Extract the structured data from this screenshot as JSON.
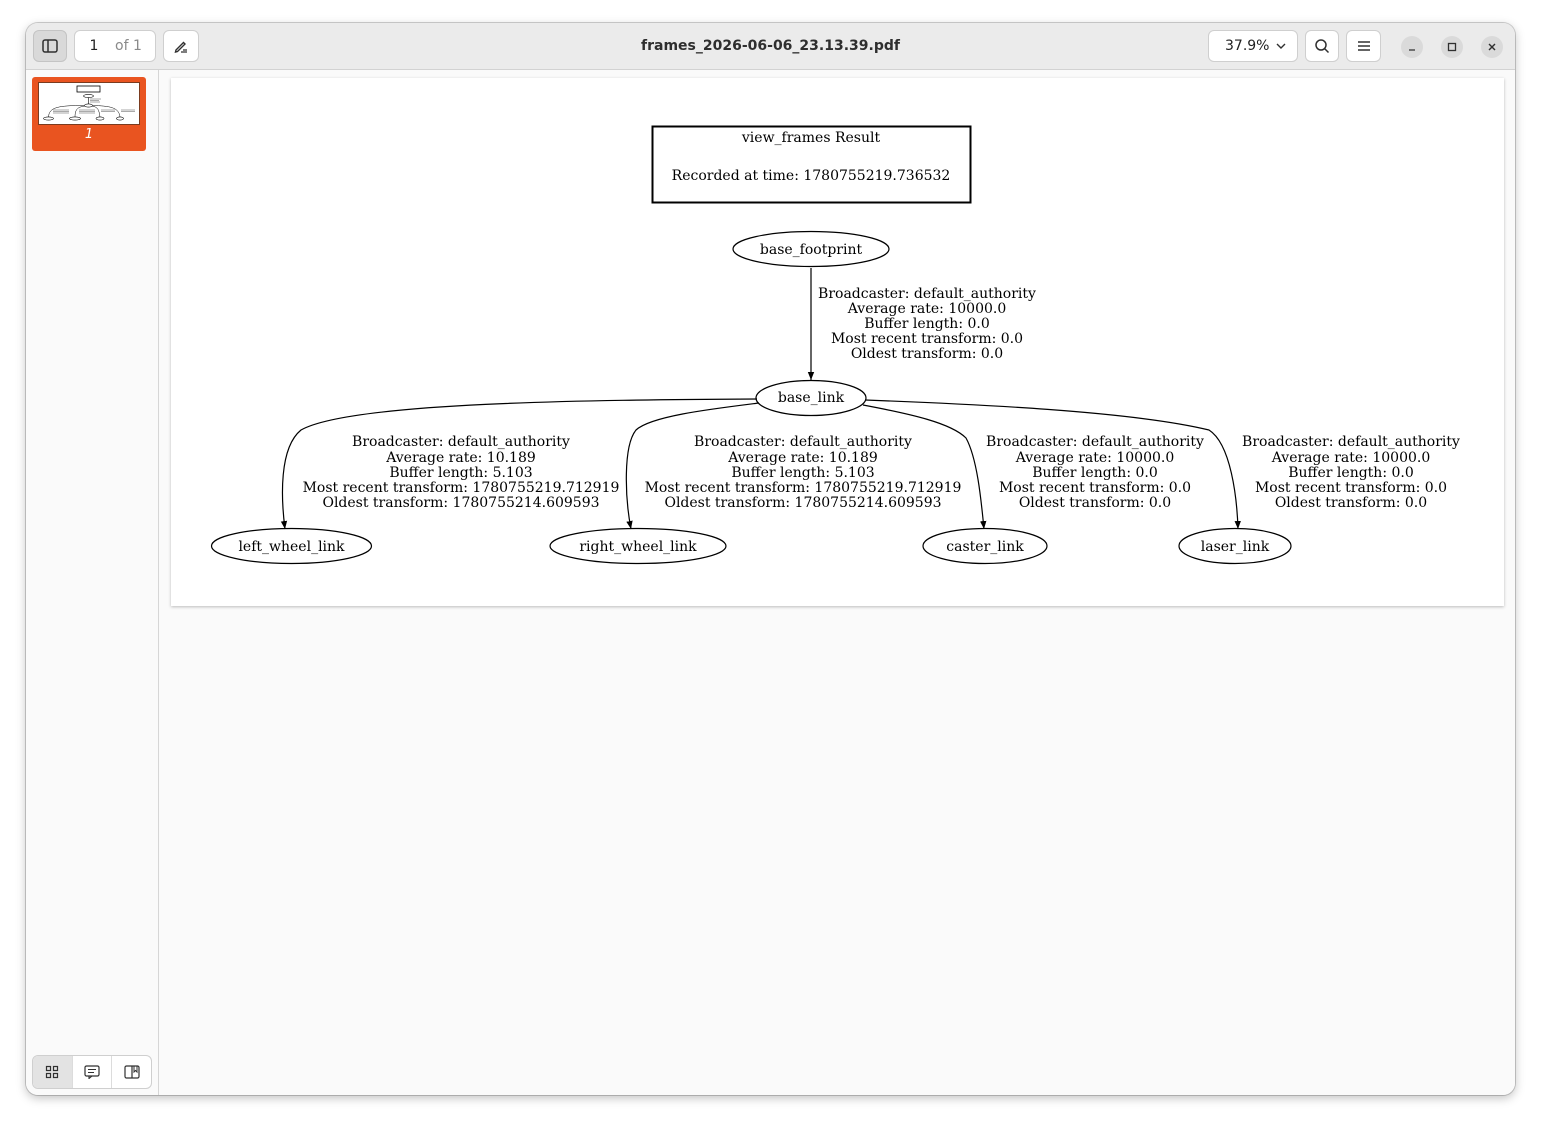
{
  "headerbar": {
    "page_current": "1",
    "page_of": "of 1",
    "title": "frames_2026-06-06_23.13.39.pdf",
    "zoom": "37.9%",
    "icons": [
      "sidebar-toggle-icon",
      "annotate-pen-icon",
      "chevron-down-icon",
      "search-icon",
      "hamburger-menu-icon",
      "minimize-icon",
      "maximize-icon",
      "close-icon"
    ]
  },
  "sidebar": {
    "thumbnail_label": "1",
    "accent_color": "#e95420",
    "tools": [
      "thumbnails-grid-icon",
      "annotations-icon",
      "bookmarks-icon"
    ]
  },
  "diagram": {
    "header_title": "view_frames Result",
    "header_time": "Recorded at time: 1780755219.736532",
    "nodes": {
      "base_footprint": "base_footprint",
      "base_link": "base_link",
      "left_wheel_link": "left_wheel_link",
      "right_wheel_link": "right_wheel_link",
      "caster_link": "caster_link",
      "laser_link": "laser_link"
    },
    "edges": [
      {
        "from": "base_footprint",
        "to": "base_link",
        "lines": [
          "Broadcaster: default_authority",
          "Average rate: 10000.0",
          "Buffer length: 0.0",
          "Most recent transform: 0.0",
          "Oldest transform: 0.0"
        ]
      },
      {
        "from": "base_link",
        "to": "left_wheel_link",
        "lines": [
          "Broadcaster: default_authority",
          "Average rate: 10.189",
          "Buffer length: 5.103",
          "Most recent transform: 1780755219.712919",
          "Oldest transform: 1780755214.609593"
        ]
      },
      {
        "from": "base_link",
        "to": "right_wheel_link",
        "lines": [
          "Broadcaster: default_authority",
          "Average rate: 10.189",
          "Buffer length: 5.103",
          "Most recent transform: 1780755219.712919",
          "Oldest transform: 1780755214.609593"
        ]
      },
      {
        "from": "base_link",
        "to": "caster_link",
        "lines": [
          "Broadcaster: default_authority",
          "Average rate: 10000.0",
          "Buffer length: 0.0",
          "Most recent transform: 0.0",
          "Oldest transform: 0.0"
        ]
      },
      {
        "from": "base_link",
        "to": "laser_link",
        "lines": [
          "Broadcaster: default_authority",
          "Average rate: 10000.0",
          "Buffer length: 0.0",
          "Most recent transform: 0.0",
          "Oldest transform: 0.0"
        ]
      }
    ]
  }
}
